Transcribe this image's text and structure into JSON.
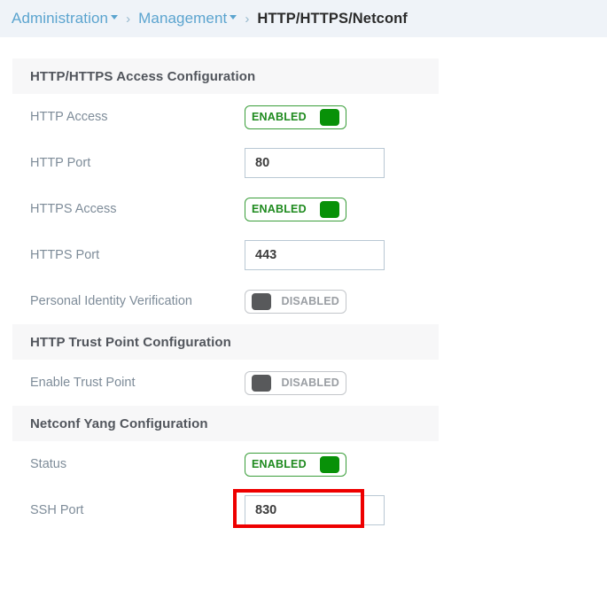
{
  "breadcrumb": {
    "items": [
      {
        "label": "Administration",
        "has_caret": true,
        "current": false
      },
      {
        "label": "Management",
        "has_caret": true,
        "current": false
      },
      {
        "label": "HTTP/HTTPS/Netconf",
        "has_caret": false,
        "current": true
      }
    ],
    "separator": "›"
  },
  "sections": [
    {
      "title": "HTTP/HTTPS Access Configuration",
      "rows": [
        {
          "label": "HTTP Access",
          "control": "toggle",
          "value": "ENABLED",
          "state": "on"
        },
        {
          "label": "HTTP Port",
          "control": "input",
          "value": "80"
        },
        {
          "label": "HTTPS Access",
          "control": "toggle",
          "value": "ENABLED",
          "state": "on"
        },
        {
          "label": "HTTPS Port",
          "control": "input",
          "value": "443"
        },
        {
          "label": "Personal Identity Verification",
          "control": "toggle",
          "value": "DISABLED",
          "state": "off"
        }
      ]
    },
    {
      "title": "HTTP Trust Point Configuration",
      "rows": [
        {
          "label": "Enable Trust Point",
          "control": "toggle",
          "value": "DISABLED",
          "state": "off"
        }
      ]
    },
    {
      "title": "Netconf Yang Configuration",
      "rows": [
        {
          "label": "Status",
          "control": "toggle",
          "value": "ENABLED",
          "state": "on",
          "highlighted": true
        },
        {
          "label": "SSH Port",
          "control": "input",
          "value": "830"
        }
      ]
    }
  ],
  "colors": {
    "breadcrumb_bg": "#eff3f8",
    "breadcrumb_link": "#5ba4cf",
    "breadcrumb_current": "#2b2b2b",
    "section_header_bg": "#f7f7f8",
    "section_header_text": "#51555c",
    "label_text": "#7e8c99",
    "toggle_on_border": "#3a9e3a",
    "toggle_on_text": "#1e8a1e",
    "toggle_on_knob": "#089108",
    "toggle_off_border": "#c3c6ca",
    "toggle_off_text": "#9a9ea3",
    "toggle_off_knob": "#58595b",
    "input_border": "#b9c8d4",
    "annotation": "#ee0000"
  }
}
